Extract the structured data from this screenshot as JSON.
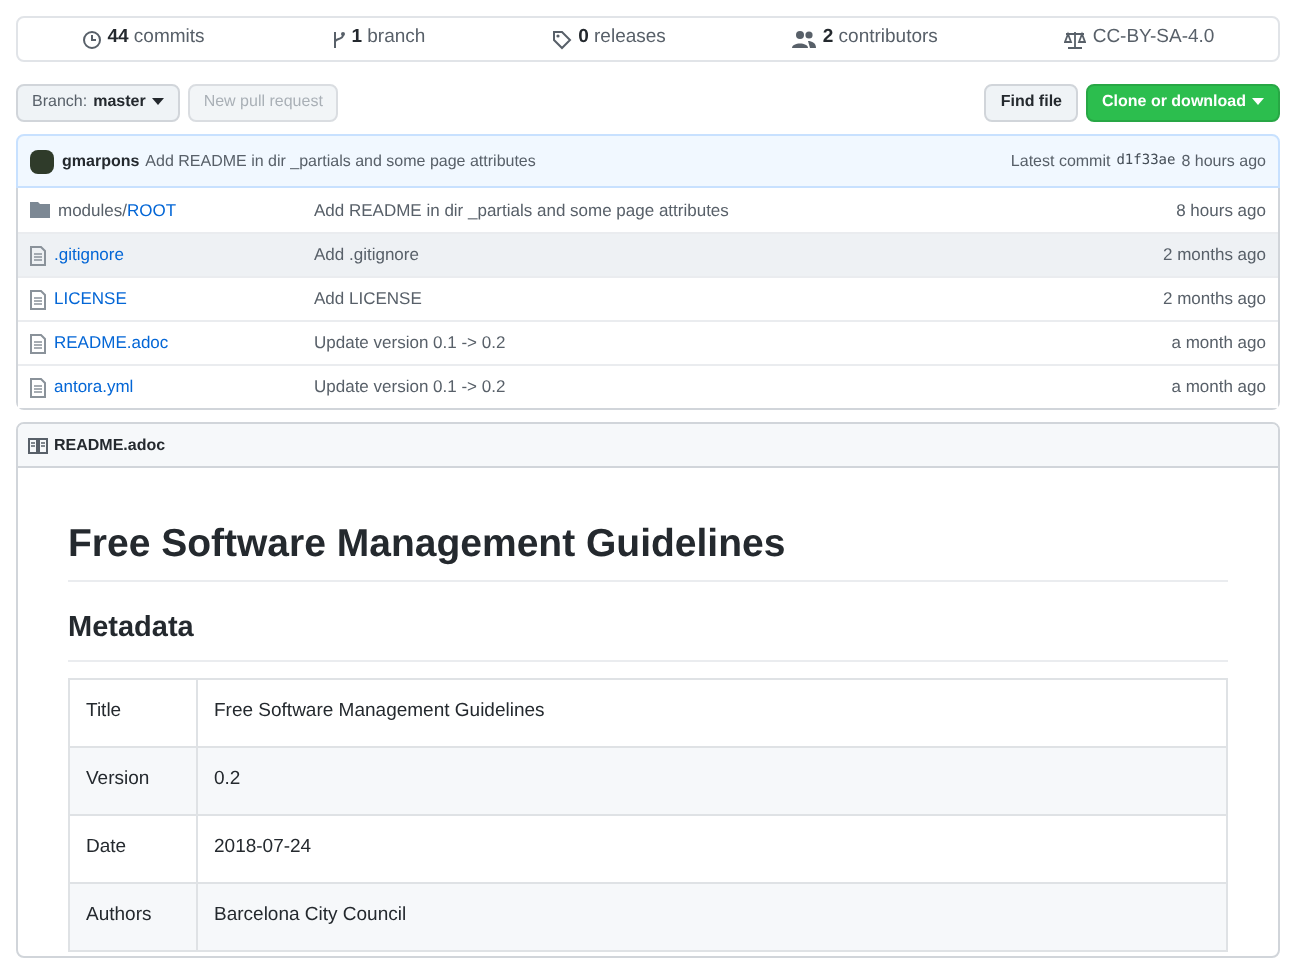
{
  "stats": [
    {
      "kind": "commits",
      "count": "44",
      "label": "commits"
    },
    {
      "kind": "branch",
      "count": "1",
      "label": "branch"
    },
    {
      "kind": "releases",
      "count": "0",
      "label": "releases"
    },
    {
      "kind": "contributors",
      "count": "2",
      "label": "contributors"
    },
    {
      "kind": "license",
      "label": "CC-BY-SA-4.0"
    }
  ],
  "branch_button": {
    "prefix": "Branch:",
    "value": "master"
  },
  "new_pull_request": {
    "label": "New pull request",
    "disabled": true
  },
  "find_file": "Find file",
  "clone_button": "Clone or download",
  "latest_commit": {
    "author": "gmarpons",
    "message": "Add README in dir _partials and some page attributes",
    "prefix": "Latest commit",
    "hash": "d1f33ae",
    "time": "8 hours ago"
  },
  "files": [
    {
      "kind": "folder",
      "path": "modules/",
      "name": "ROOT",
      "message": "Add README in dir _partials and some page attributes",
      "age": "8 hours ago",
      "hovered": false
    },
    {
      "kind": "file",
      "name": ".gitignore",
      "message": "Add .gitignore",
      "age": "2 months ago",
      "hovered": true
    },
    {
      "kind": "file",
      "name": "LICENSE",
      "message": "Add LICENSE",
      "age": "2 months ago",
      "hovered": false
    },
    {
      "kind": "file",
      "name": "README.adoc",
      "message": "Update version 0.1 -> 0.2",
      "age": "a month ago",
      "hovered": false
    },
    {
      "kind": "file",
      "name": "antora.yml",
      "message": "Update version 0.1 -> 0.2",
      "age": "a month ago",
      "hovered": false
    }
  ],
  "readme": {
    "filename": "README.adoc",
    "title": "Free Software Management Guidelines",
    "section": "Metadata",
    "table": [
      [
        "Title",
        "Free Software Management Guidelines"
      ],
      [
        "Version",
        "0.2"
      ],
      [
        "Date",
        "2018-07-24"
      ],
      [
        "Authors",
        "Barcelona City Council"
      ]
    ]
  }
}
